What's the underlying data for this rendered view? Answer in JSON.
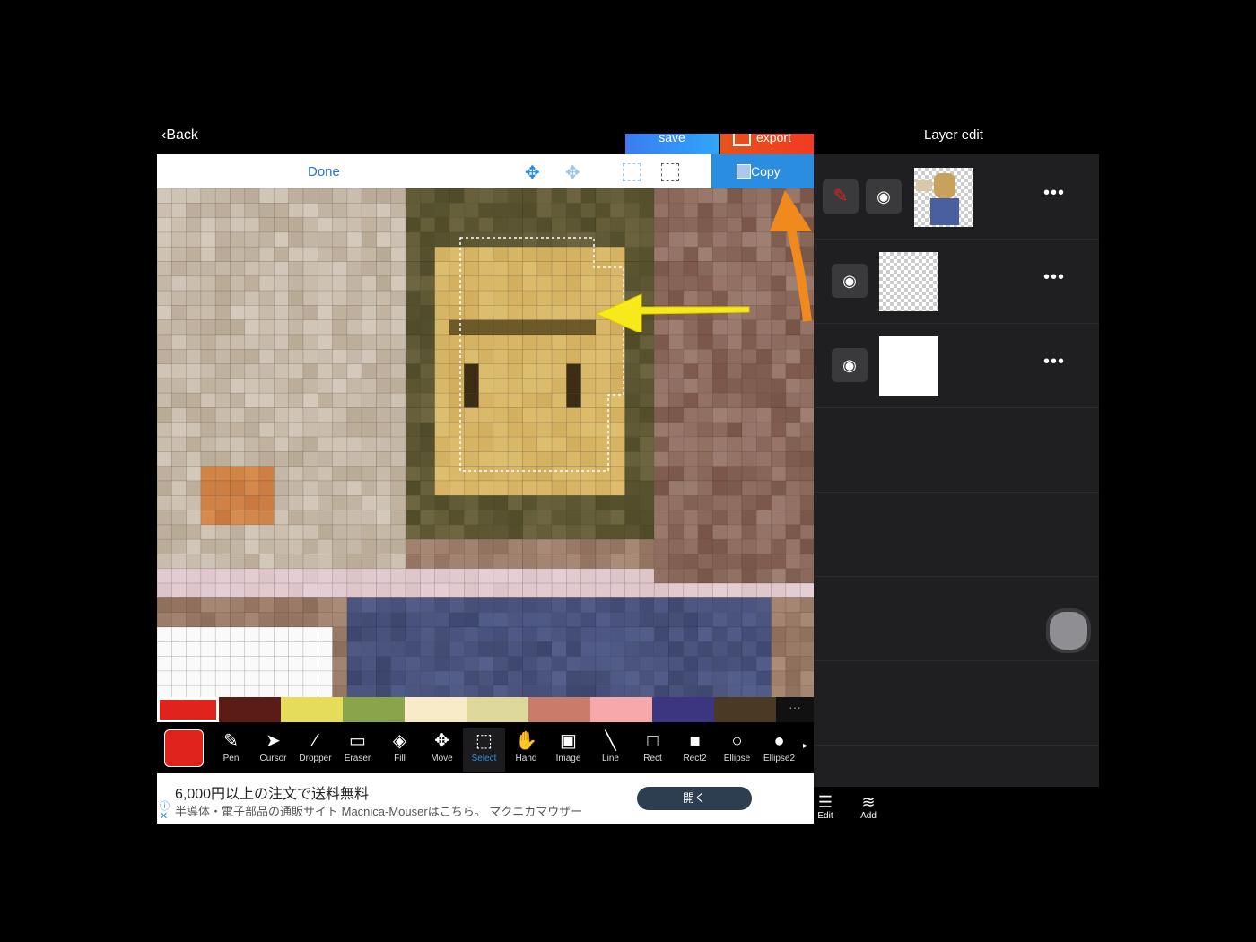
{
  "header": {
    "back_label": "Back",
    "save_label": "save",
    "export_label": "export",
    "layer_panel_title": "Layer edit"
  },
  "selection_toolbar": {
    "done_label": "Done",
    "copy_label": "Copy"
  },
  "palette": {
    "colors": [
      "#e0231d",
      "#5a1c14",
      "#e5dc5a",
      "#8aa44a",
      "#f8ebc8",
      "#ded89a",
      "#c97c6a",
      "#f7a8aa",
      "#3c3580",
      "#4a3a24"
    ],
    "selected_index": 0,
    "more_label": "···"
  },
  "current_color": "#e0231d",
  "tools": [
    {
      "label": "Pen",
      "icon": "pen-icon"
    },
    {
      "label": "Cursor",
      "icon": "cursor-icon"
    },
    {
      "label": "Dropper",
      "icon": "dropper-icon"
    },
    {
      "label": "Eraser",
      "icon": "eraser-icon"
    },
    {
      "label": "Fill",
      "icon": "fill-icon"
    },
    {
      "label": "Move",
      "icon": "move-icon"
    },
    {
      "label": "Select",
      "icon": "select-icon",
      "active": true
    },
    {
      "label": "Hand",
      "icon": "hand-icon"
    },
    {
      "label": "Image",
      "icon": "image-icon"
    },
    {
      "label": "Line",
      "icon": "line-icon"
    },
    {
      "label": "Rect",
      "icon": "rect-icon"
    },
    {
      "label": "Rect2",
      "icon": "rect2-icon"
    },
    {
      "label": "Ellipse",
      "icon": "ellipse-icon"
    },
    {
      "label": "Ellipse2",
      "icon": "ellipse2-icon"
    }
  ],
  "ad": {
    "title": "6,000円以上の注文で送料無料",
    "subtitle": "半導体・電子部品の通販サイト Macnica-Mouserはこちら。 マクニカマウザー",
    "button_label": "開く"
  },
  "layers": [
    {
      "editing": true,
      "visible": true,
      "thumbnail": "photo"
    },
    {
      "editing": false,
      "visible": true,
      "thumbnail": "transparent"
    },
    {
      "editing": false,
      "visible": true,
      "thumbnail": "white"
    }
  ],
  "bottom_tabs": [
    {
      "label": "Edit",
      "icon": "list-icon"
    },
    {
      "label": "Add",
      "icon": "layers-add-icon"
    }
  ]
}
